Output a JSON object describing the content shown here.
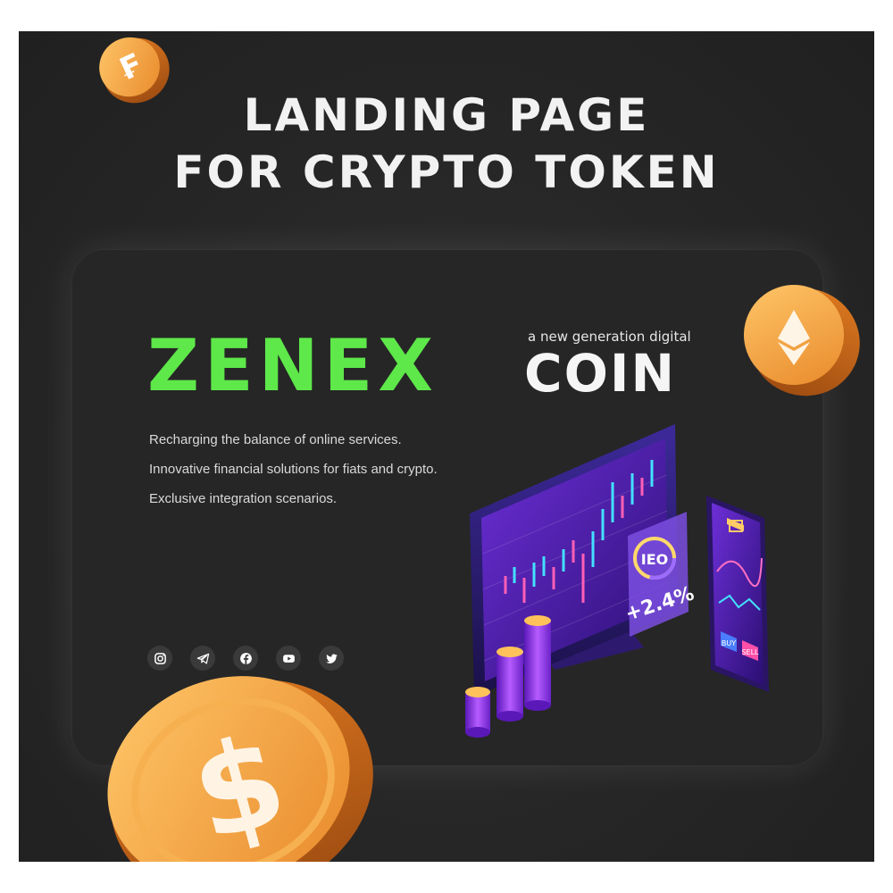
{
  "headline": {
    "line1": "LANDING PAGE",
    "line2": "FOR CRYPTO TOKEN"
  },
  "hero": {
    "brand": "ZENEX",
    "tagline": "a new generation digital",
    "product": "COIN",
    "features": [
      "Recharging the balance of online services.",
      "Innovative financial solutions for fiats and crypto.",
      "Exclusive integration scenarios."
    ]
  },
  "socials": [
    {
      "icon": "instagram-icon"
    },
    {
      "icon": "telegram-icon"
    },
    {
      "icon": "facebook-icon"
    },
    {
      "icon": "youtube-icon"
    },
    {
      "icon": "twitter-icon"
    }
  ],
  "illustration": {
    "ieo_badge": "IEO",
    "ieo_change": "+2.4%",
    "buy_label": "BUY",
    "sell_label": "SELL"
  },
  "colors": {
    "background": "#262626",
    "brand_green": "#5ee84a",
    "coin_orange": "#f0a13c",
    "accent_purple": "#7a3cf0"
  }
}
